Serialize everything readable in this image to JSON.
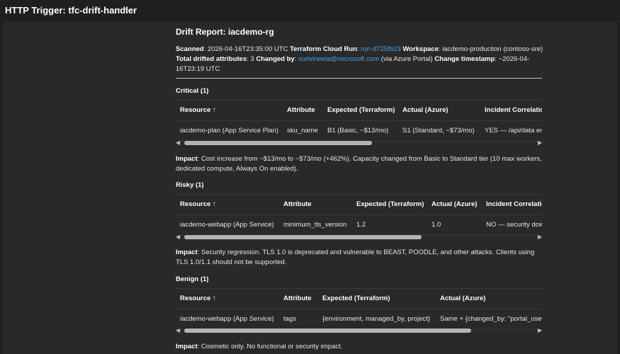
{
  "app": {
    "title": "HTTP Trigger: tfc-drift-handler",
    "more_icon": "⋯"
  },
  "report": {
    "title": "Drift Report: iacdemo-rg",
    "scanned_label": "Scanned",
    "scanned_value": ": 2026-04-16T23:35:00 UTC ",
    "run_label": "Terraform Cloud Run",
    "run_sep": ": ",
    "run_link": "run-d725fb23",
    "workspace_label": " Workspace",
    "workspace_value": ": iacdemo-production (contoso-sre)",
    "total_label": "Total drifted attributes",
    "total_value": ": 3 ",
    "changed_by_label": "Changed by",
    "changed_by_sep": ": ",
    "changed_by_link": "surivineela@microsoft.com",
    "changed_by_via": " (via Azure Portal) ",
    "change_ts_label": "Change timestamp",
    "change_ts_value": ": ~2026-04-16T23:19 UTC"
  },
  "sections": {
    "critical": {
      "title": "Critical (1)",
      "headers": [
        "Resource ↑",
        "Attribute",
        "Expected (Terraform)",
        "Actual (Azure)",
        "Incident Correlation"
      ],
      "row": [
        "iacdemo-plan (App Service Plan)",
        "sku_name",
        "B1 (Basic, ~$13/mo)",
        "S1 (Standard, ~$73/mo)",
        "YES — /api/data endpoint"
      ],
      "impact_label": "Impact",
      "impact_text": ": Cost increase from ~$13/mo to ~$73/mo (+462%). Capacity changed from Basic to Standard tier (10 max workers, dedicated compute, Always On enabled)."
    },
    "risky": {
      "title": "Risky (1)",
      "headers": [
        "Resource ↑",
        "Attribute",
        "Expected (Terraform)",
        "Actual (Azure)",
        "Incident Correlation"
      ],
      "row": [
        "iacdemo-webapp (App Service)",
        "minimum_tls_version",
        "1.2",
        "1.0",
        "NO — security downgrade"
      ],
      "impact_label": "Impact",
      "impact_text": ": Security regression. TLS 1.0 is deprecated and vulnerable to BEAST, POODLE, and other attacks. Clients using TLS 1.0/1.1 should not be supported."
    },
    "benign": {
      "title": "Benign (1)",
      "headers": [
        "Resource ↑",
        "Attribute",
        "Expected (Terraform)",
        "Actual (Azure)"
      ],
      "row": [
        "iacdemo-webapp (App Service)",
        "tags",
        "{environment, managed_by, project}",
        "Same + {changed_by: \"portal_user\"}"
      ],
      "impact_label": "Impact",
      "impact_text": ": Cosmetic only. No functional or security impact."
    }
  },
  "scroll": {
    "left_arrow": "◀",
    "right_arrow": "▶"
  }
}
